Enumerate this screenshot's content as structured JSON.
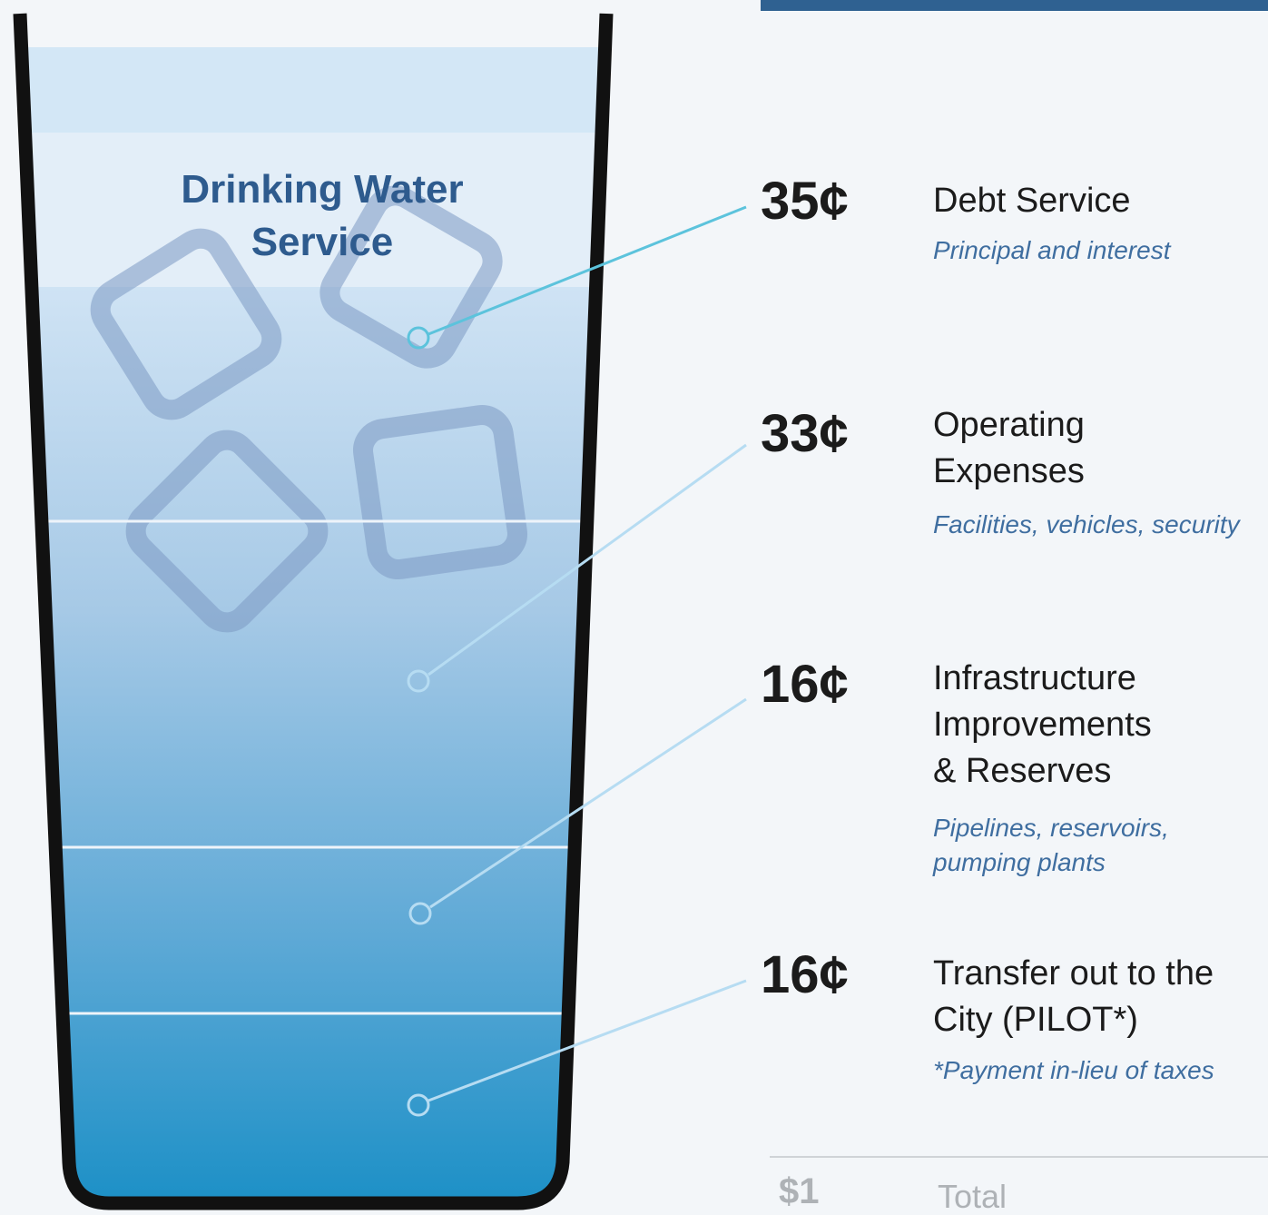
{
  "title_lines": [
    "Drinking Water",
    "Service"
  ],
  "categories": [
    {
      "amount": "35¢",
      "label_lines": [
        "Debt Service"
      ],
      "desc_lines": [
        "Principal and interest"
      ]
    },
    {
      "amount": "33¢",
      "label_lines": [
        "Operating",
        "Expenses"
      ],
      "desc_lines": [
        "Facilities, vehicles, security"
      ]
    },
    {
      "amount": "16¢",
      "label_lines": [
        "Infrastructure",
        "Improvements",
        "& Reserves"
      ],
      "desc_lines": [
        "Pipelines, reservoirs,",
        "pumping plants"
      ]
    },
    {
      "amount": "16¢",
      "label_lines": [
        "Transfer out to the",
        "City (PILOT*)"
      ],
      "desc_lines": [
        "*Payment in-lieu of taxes"
      ]
    }
  ],
  "total": {
    "amount": "$1",
    "label": "Total"
  },
  "colors": {
    "glass_outline": "#111111",
    "title": "#2e5b8e",
    "header_band": "#2f6191",
    "water_top": "#cfe3f4",
    "water_bottom": "#1a8fc6",
    "leader_debt": "#5cc3dc",
    "leader_other": "#b6dcf2",
    "ice_cube": "#7d99c4"
  },
  "icons": [
    "ice-cube-icon",
    "glass-icon",
    "leader-marker-icon"
  ]
}
